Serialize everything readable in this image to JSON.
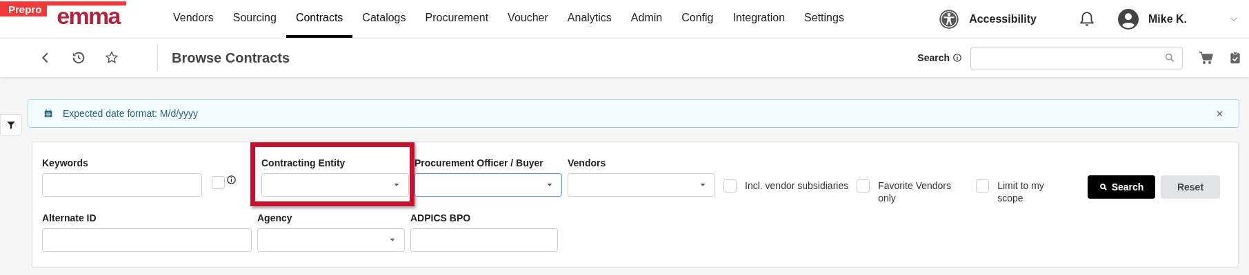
{
  "environment_banner": "Prepro",
  "logo": {
    "text": "emma"
  },
  "nav": [
    {
      "label": "Vendors",
      "selected": false
    },
    {
      "label": "Sourcing",
      "selected": false
    },
    {
      "label": "Contracts",
      "selected": true
    },
    {
      "label": "Catalogs",
      "selected": false
    },
    {
      "label": "Procurement",
      "selected": false
    },
    {
      "label": "Voucher",
      "selected": false
    },
    {
      "label": "Analytics",
      "selected": false
    },
    {
      "label": "Admin",
      "selected": false
    },
    {
      "label": "Config",
      "selected": false
    },
    {
      "label": "Integration",
      "selected": false
    },
    {
      "label": "Settings",
      "selected": false
    }
  ],
  "accessibility": "Accessibility",
  "user": "Mike K.",
  "page_title": "Browse Contracts",
  "search_label": "Search",
  "alert": "Expected date format: M/d/yyyy",
  "filters": [
    [
      {
        "kind": "text",
        "label": "Keywords"
      },
      {
        "kind": "checkbox",
        "checked": false,
        "info": true
      },
      {
        "kind": "select",
        "label": "Contracting Entity",
        "highlighted": true
      },
      {
        "kind": "select",
        "label": "Procurement Officer / Buyer",
        "focused": true
      },
      {
        "kind": "select",
        "label": "Vendors"
      },
      {
        "kind": "checkbox",
        "label": "Incl. vendor subsidiaries",
        "checked": false
      },
      {
        "kind": "checkbox",
        "label": "Favorite Vendors only",
        "checked": false
      },
      {
        "kind": "checkbox",
        "label": "Limit to my scope",
        "checked": false
      }
    ],
    [
      {
        "kind": "text",
        "label": "Alternate ID"
      },
      {
        "kind": "select",
        "label": "Agency"
      },
      {
        "kind": "text",
        "label": "ADPICS BPO"
      }
    ]
  ],
  "buttons": [
    {
      "label": "Search",
      "kind": "primary"
    },
    {
      "label": "Reset",
      "kind": "secondary"
    }
  ]
}
